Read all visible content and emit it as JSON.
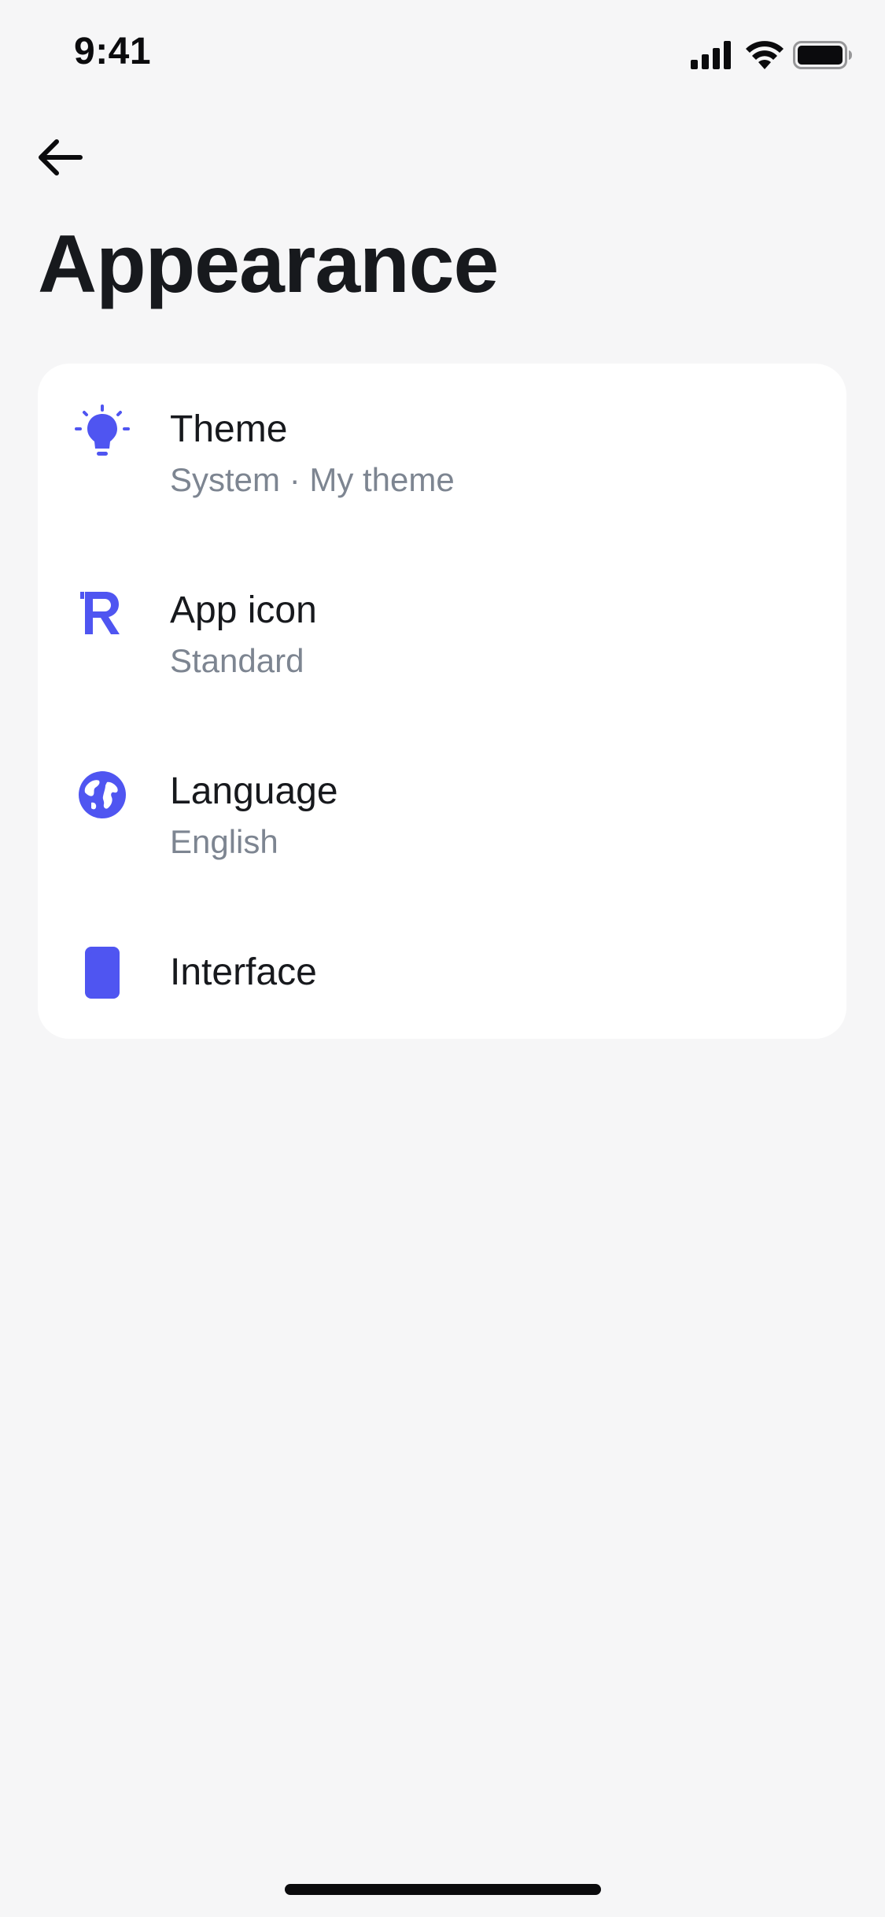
{
  "status_bar": {
    "time": "9:41",
    "icons": [
      "cellular-signal-icon",
      "wifi-icon",
      "battery-icon"
    ]
  },
  "header": {
    "back_icon": "arrow-left-icon",
    "title": "Appearance"
  },
  "settings": {
    "items": [
      {
        "icon": "lightbulb-icon",
        "title": "Theme",
        "subtitle": "System · My theme"
      },
      {
        "icon": "app-logo-r-icon",
        "title": "App icon",
        "subtitle": "Standard"
      },
      {
        "icon": "globe-icon",
        "title": "Language",
        "subtitle": "English"
      },
      {
        "icon": "phone-device-icon",
        "title": "Interface"
      }
    ]
  },
  "colors": {
    "accent": "#4f55f1",
    "background": "#f6f6f7",
    "card": "#ffffff",
    "title_text": "#17191d",
    "secondary_text": "#7d8591"
  }
}
